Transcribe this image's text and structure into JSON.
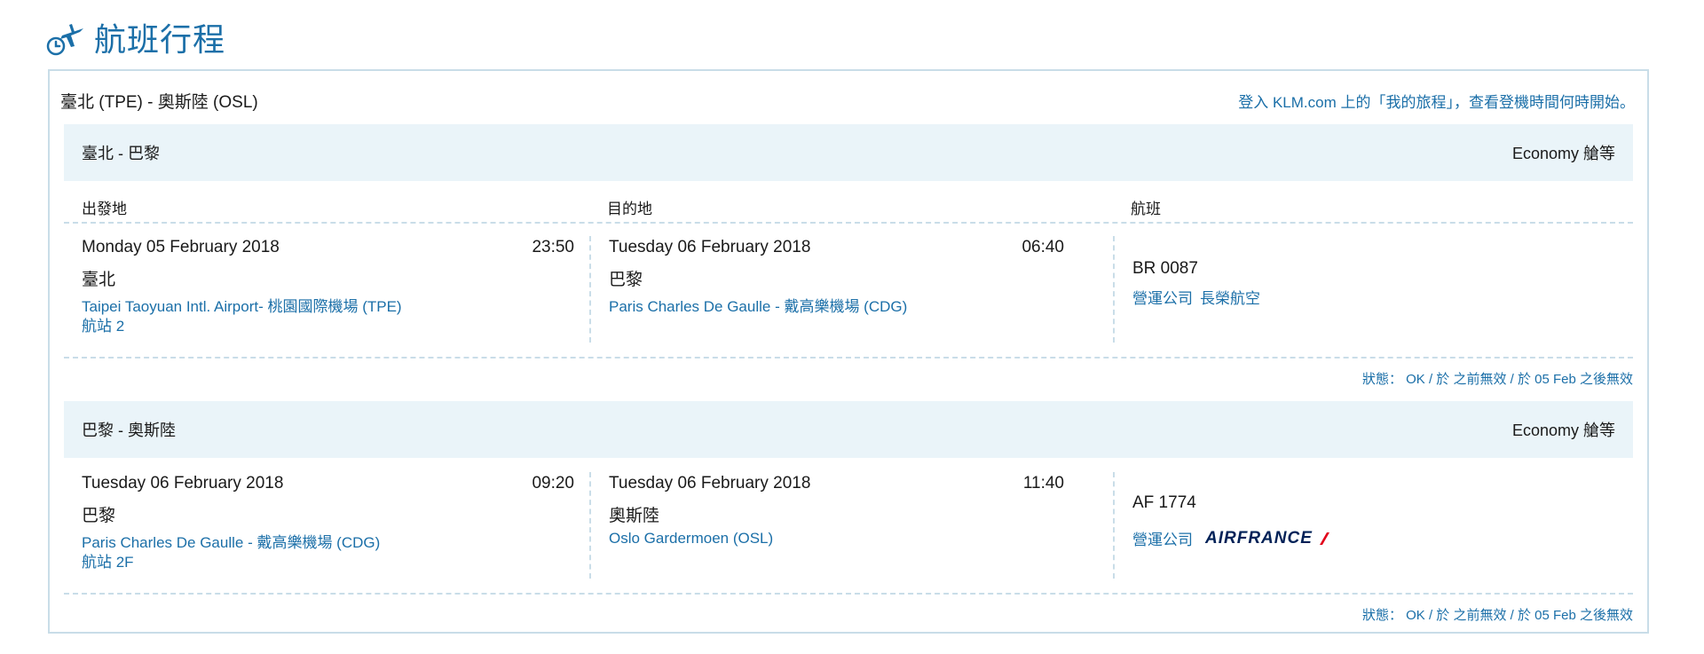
{
  "heading": {
    "title": "航班行程",
    "icon": "plane-clock-icon"
  },
  "trip": {
    "route": "臺北 (TPE) - 奧斯陸 (OSL)",
    "link_text": "登入 KLM.com 上的「我的旅程」，查看登機時間何時開始。"
  },
  "columns": {
    "departure": "出發地",
    "arrival": "目的地",
    "flight": "航班"
  },
  "segments": [
    {
      "route": "臺北 - 巴黎",
      "cabin": "Economy 艙等",
      "dep": {
        "date": "Monday 05 February 2018",
        "time": "23:50",
        "city": "臺北",
        "airport": "Taipei Taoyuan Intl. Airport- 桃園國際機場 (TPE)",
        "terminal": "航站 2"
      },
      "arr": {
        "date": "Tuesday 06 February 2018",
        "time": "06:40",
        "city": "巴黎",
        "airport": "Paris Charles De Gaulle - 戴高樂機場 (CDG)"
      },
      "flight": {
        "number": "BR 0087",
        "operator_label": "營運公司",
        "operator_name": "長榮航空"
      },
      "status": "狀態： OK / 於 之前無效 / 於 05 Feb 之後無效"
    },
    {
      "route": "巴黎 - 奧斯陸",
      "cabin": "Economy 艙等",
      "dep": {
        "date": "Tuesday 06 February 2018",
        "time": "09:20",
        "city": "巴黎",
        "airport": "Paris Charles De Gaulle - 戴高樂機場 (CDG)",
        "terminal": "航站 2F"
      },
      "arr": {
        "date": "Tuesday 06 February 2018",
        "time": "11:40",
        "city": "奧斯陸",
        "airport": "Oslo Gardermoen (OSL)"
      },
      "flight": {
        "number": "AF 1774",
        "operator_label": "營運公司",
        "operator_logo_text": "AIRFRANCE"
      },
      "status": "狀態： OK / 於 之前無效 / 於 05 Feb 之後無效"
    }
  ],
  "colors": {
    "accent": "#1b6fa8",
    "panel": "#eaf4f9",
    "border": "#c9dde8",
    "airfrance_navy": "#002157",
    "airfrance_red": "#e2001a"
  }
}
